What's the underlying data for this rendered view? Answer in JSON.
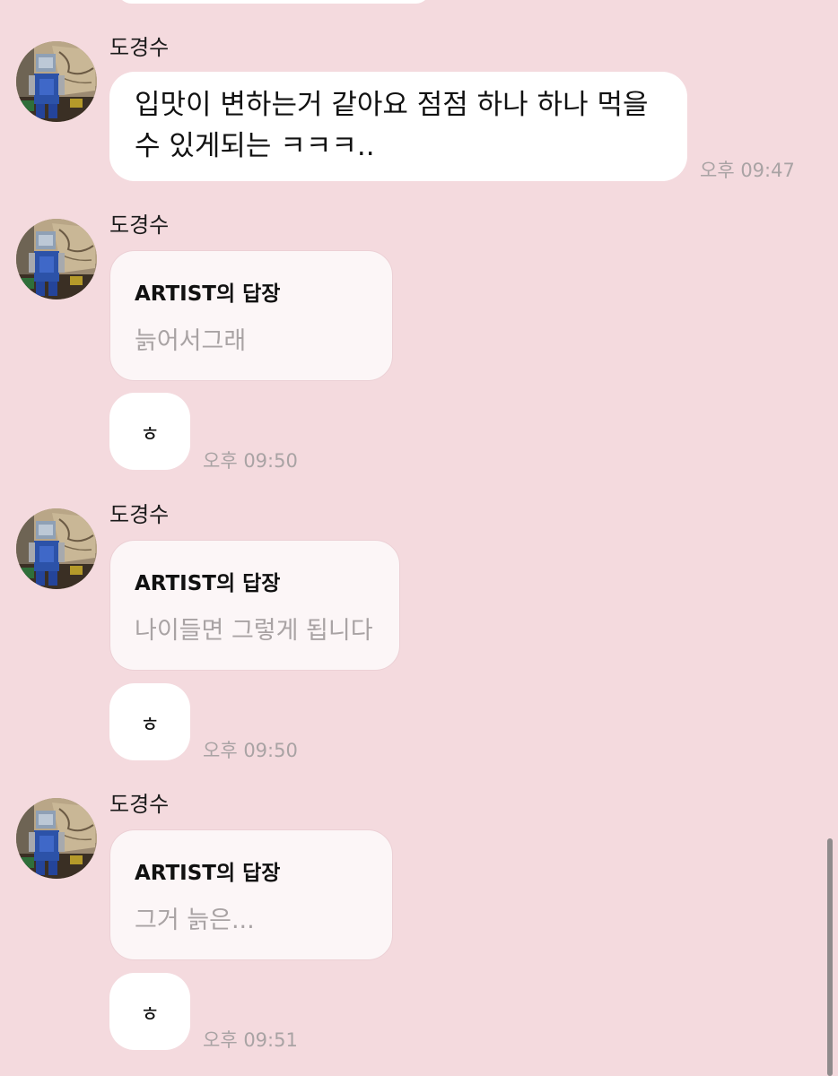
{
  "messages": [
    {
      "sender": "도경수",
      "text_lines": [
        "입맛이 변하는거 같아요 점점 하나 하나 먹을",
        "수 있게되는 ㅋㅋㅋ.."
      ],
      "time": "오후 09:47"
    },
    {
      "sender": "도경수",
      "reply_title": "ARTIST의 답장",
      "reply_text": "늙어서그래",
      "reaction": "ㅎ",
      "time": "오후 09:50"
    },
    {
      "sender": "도경수",
      "reply_title": "ARTIST의 답장",
      "reply_text": "나이들면 그렇게 됩니다",
      "reaction": "ㅎ",
      "time": "오후 09:50"
    },
    {
      "sender": "도경수",
      "reply_title": "ARTIST의 답장",
      "reply_text": "그거 늙은...",
      "reaction": "ㅎ",
      "time": "오후 09:51"
    }
  ],
  "colors": {
    "background": "#f4dade",
    "bubble": "#ffffff",
    "reply_card": "#fcf6f7",
    "muted_text": "#a9a3a4"
  },
  "icons": [
    "avatar-robot-image"
  ]
}
